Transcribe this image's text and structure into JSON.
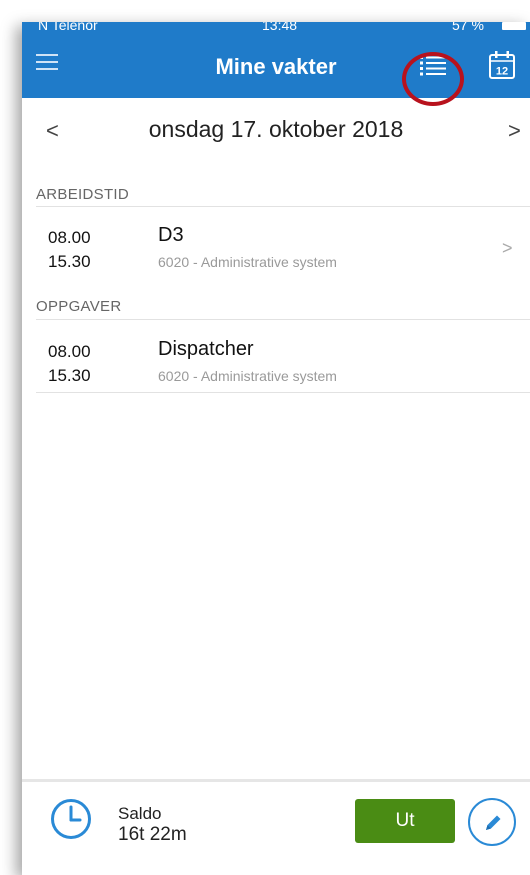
{
  "status_bar": {
    "carrier": "N Telenor",
    "time": "13:48",
    "battery": "57 %"
  },
  "header": {
    "title": "Mine vakter",
    "menu_icon": "hamburger-menu-icon",
    "list_icon": "list-view-icon",
    "calendar_icon": "calendar-icon",
    "calendar_day": "12",
    "accent_color": "#1f7bc9"
  },
  "date_nav": {
    "prev": "<",
    "date": "onsdag 17. oktober 2018",
    "next": ">"
  },
  "sections": {
    "arbeidstid": {
      "title": "ARBEIDSTID",
      "items": [
        {
          "start": "08.00",
          "end": "15.30",
          "name": "D3",
          "detail": "6020 - Administrative system",
          "chevron": ">"
        }
      ]
    },
    "oppgaver": {
      "title": "OPPGAVER",
      "items": [
        {
          "start": "08.00",
          "end": "15.30",
          "name": "Dispatcher",
          "detail": "6020 - Administrative system"
        }
      ]
    }
  },
  "footer": {
    "saldo_label": "Saldo",
    "saldo_value": "16t 22m",
    "ut_label": "Ut",
    "ut_color": "#4a8c14",
    "clock_icon": "clock-icon",
    "edit_icon": "pencil-icon"
  }
}
